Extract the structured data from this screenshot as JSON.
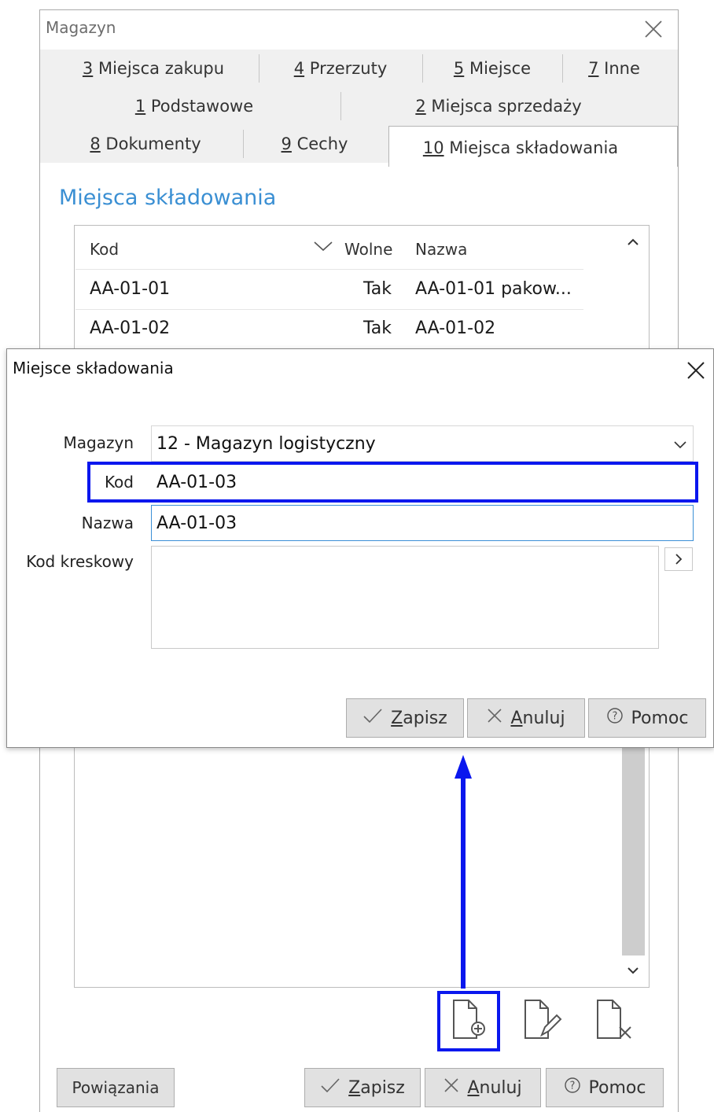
{
  "main_window": {
    "title": "Magazyn",
    "tabs_row1": [
      {
        "key": "3",
        "label": " Miejsca zakupu"
      },
      {
        "key": "4",
        "label": " Przerzuty"
      },
      {
        "key": "5",
        "label": " Miejsce"
      },
      {
        "key": "7",
        "label": " Inne"
      }
    ],
    "tabs_row2": [
      {
        "key": "1",
        "label": " Podstawowe"
      },
      {
        "key": "2",
        "label": " Miejsca sprzedaży"
      }
    ],
    "tabs_row3": [
      {
        "key": "8",
        "label": " Dokumenty"
      },
      {
        "key": "9",
        "label": " Cechy"
      },
      {
        "key": "10",
        "label": " Miejsca składowania"
      }
    ],
    "section_title": "Miejsca składowania",
    "grid": {
      "columns": [
        "Kod",
        "Wolne",
        "Nazwa"
      ],
      "rows": [
        {
          "kod": "AA-01-01",
          "wolne": "Tak",
          "nazwa": "AA-01-01 pakow..."
        },
        {
          "kod": "AA-01-02",
          "wolne": "Tak",
          "nazwa": "AA-01-02"
        }
      ]
    },
    "buttons": {
      "powiazania": "Powiązania",
      "zapisz_key": "Z",
      "zapisz_rest": "apisz",
      "anuluj_key": "A",
      "anuluj_rest": "nuluj",
      "pomoc": "Pomoc"
    }
  },
  "dialog": {
    "title": "Miejsce składowania",
    "labels": {
      "magazyn": "Magazyn",
      "kod": "Kod",
      "nazwa": "Nazwa",
      "kod_kreskowy": "Kod kreskowy"
    },
    "values": {
      "magazyn": "12 - Magazyn logistyczny",
      "kod": "AA-01-03",
      "nazwa": "AA-01-03",
      "kod_kreskowy": ""
    },
    "buttons": {
      "zapisz_key": "Z",
      "zapisz_rest": "apisz",
      "anuluj_key": "A",
      "anuluj_rest": "nuluj",
      "pomoc": "Pomoc"
    }
  },
  "colors": {
    "highlight": "#0a17ee",
    "section_title": "#3a8fd3",
    "focus_border": "#3b8fd6"
  },
  "icons": [
    "close-icon",
    "chevron-down-icon",
    "scroll-up-icon",
    "scroll-down-icon",
    "add-document-icon",
    "edit-document-icon",
    "delete-document-icon",
    "checkmark-icon",
    "x-icon",
    "help-circle-icon",
    "chevron-right-icon",
    "sort-chevron-icon"
  ]
}
